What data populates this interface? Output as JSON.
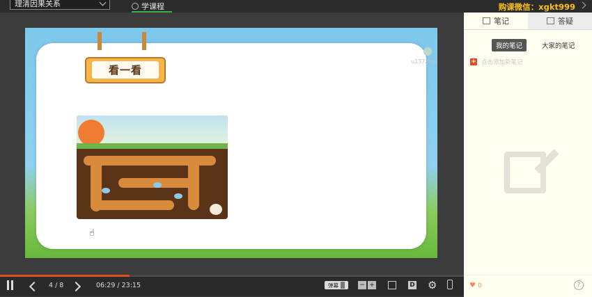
{
  "topbar": {
    "chapter_select": "理清因果关系",
    "course_tab": "学课程",
    "buy_text": "购课微信：xgkt999"
  },
  "slide": {
    "sign_title": "看一看",
    "watermark_user": "u137zmwrn31"
  },
  "sidebar": {
    "tabs": [
      {
        "label": "笔记",
        "icon": "edit-note-icon"
      },
      {
        "label": "答疑",
        "icon": "question-answer-icon"
      }
    ],
    "pills": [
      "我的笔记",
      "大家的笔记"
    ],
    "add_note": "点击添加新笔记",
    "likes": "0"
  },
  "player": {
    "page": "4 / 8",
    "time": "06:29 / 23:15",
    "progress": 0.28,
    "danmu_label": "弹幕",
    "zoom_minus": "−",
    "zoom_plus": "+",
    "d_label": "D",
    "accent": "#e14b25"
  }
}
